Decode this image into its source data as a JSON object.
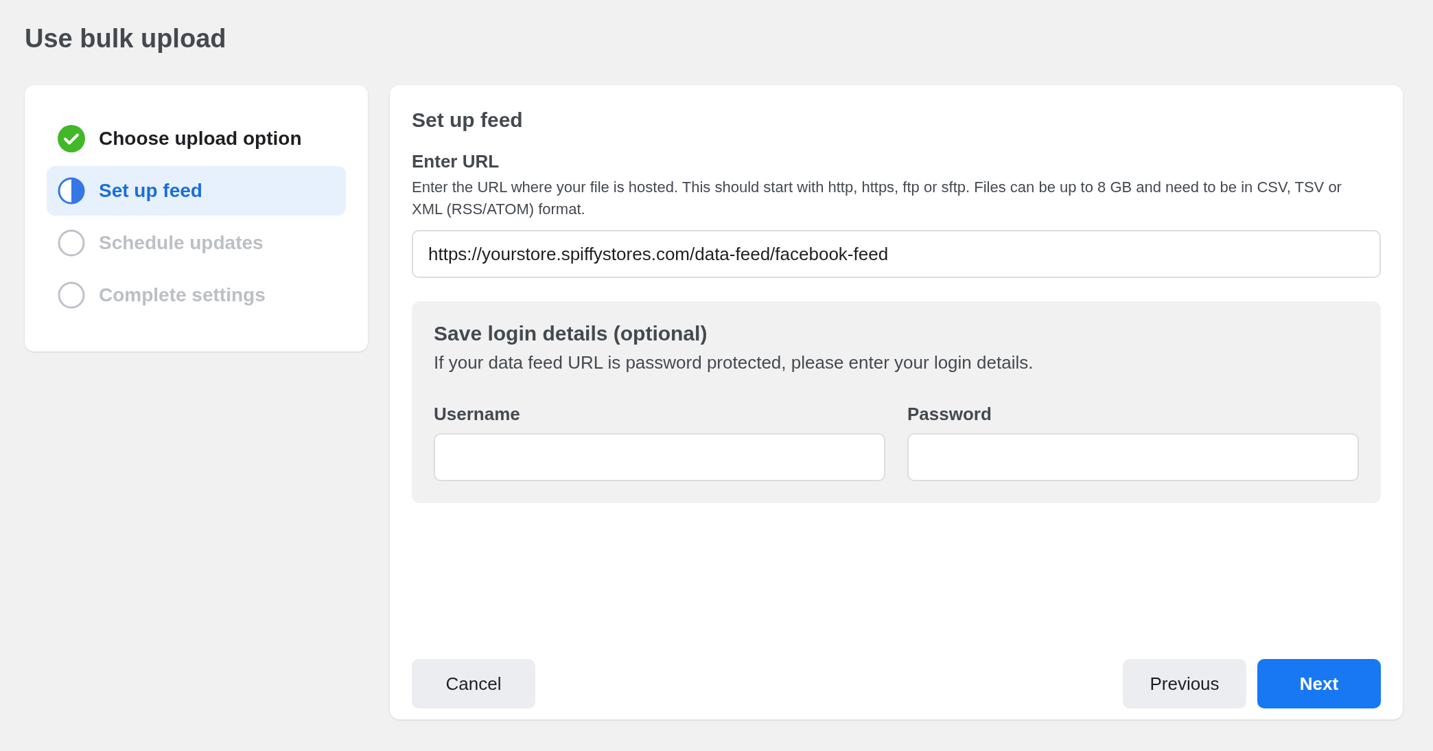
{
  "page_title": "Use bulk upload",
  "steps": [
    {
      "label": "Choose upload option",
      "kind": "done",
      "selected": false
    },
    {
      "label": "Set up feed",
      "kind": "current",
      "selected": true
    },
    {
      "label": "Schedule updates",
      "kind": "pending",
      "selected": false
    },
    {
      "label": "Complete settings",
      "kind": "pending",
      "selected": false
    }
  ],
  "panel": {
    "title": "Set up feed",
    "url_field": {
      "label": "Enter URL",
      "description": "Enter the URL where your file is hosted. This should start with http, https, ftp or sftp. Files can be up to 8 GB and need to be in CSV, TSV or XML (RSS/ATOM) format.",
      "value": "https://yourstore.spiffystores.com/data-feed/facebook-feed"
    },
    "login": {
      "title": "Save login details (optional)",
      "description": "If your data feed URL is password protected, please enter your login details.",
      "fields": [
        {
          "label": "Username"
        },
        {
          "label": "Password"
        }
      ]
    }
  },
  "buttons": {
    "cancel": "Cancel",
    "previous": "Previous",
    "next": "Next"
  }
}
